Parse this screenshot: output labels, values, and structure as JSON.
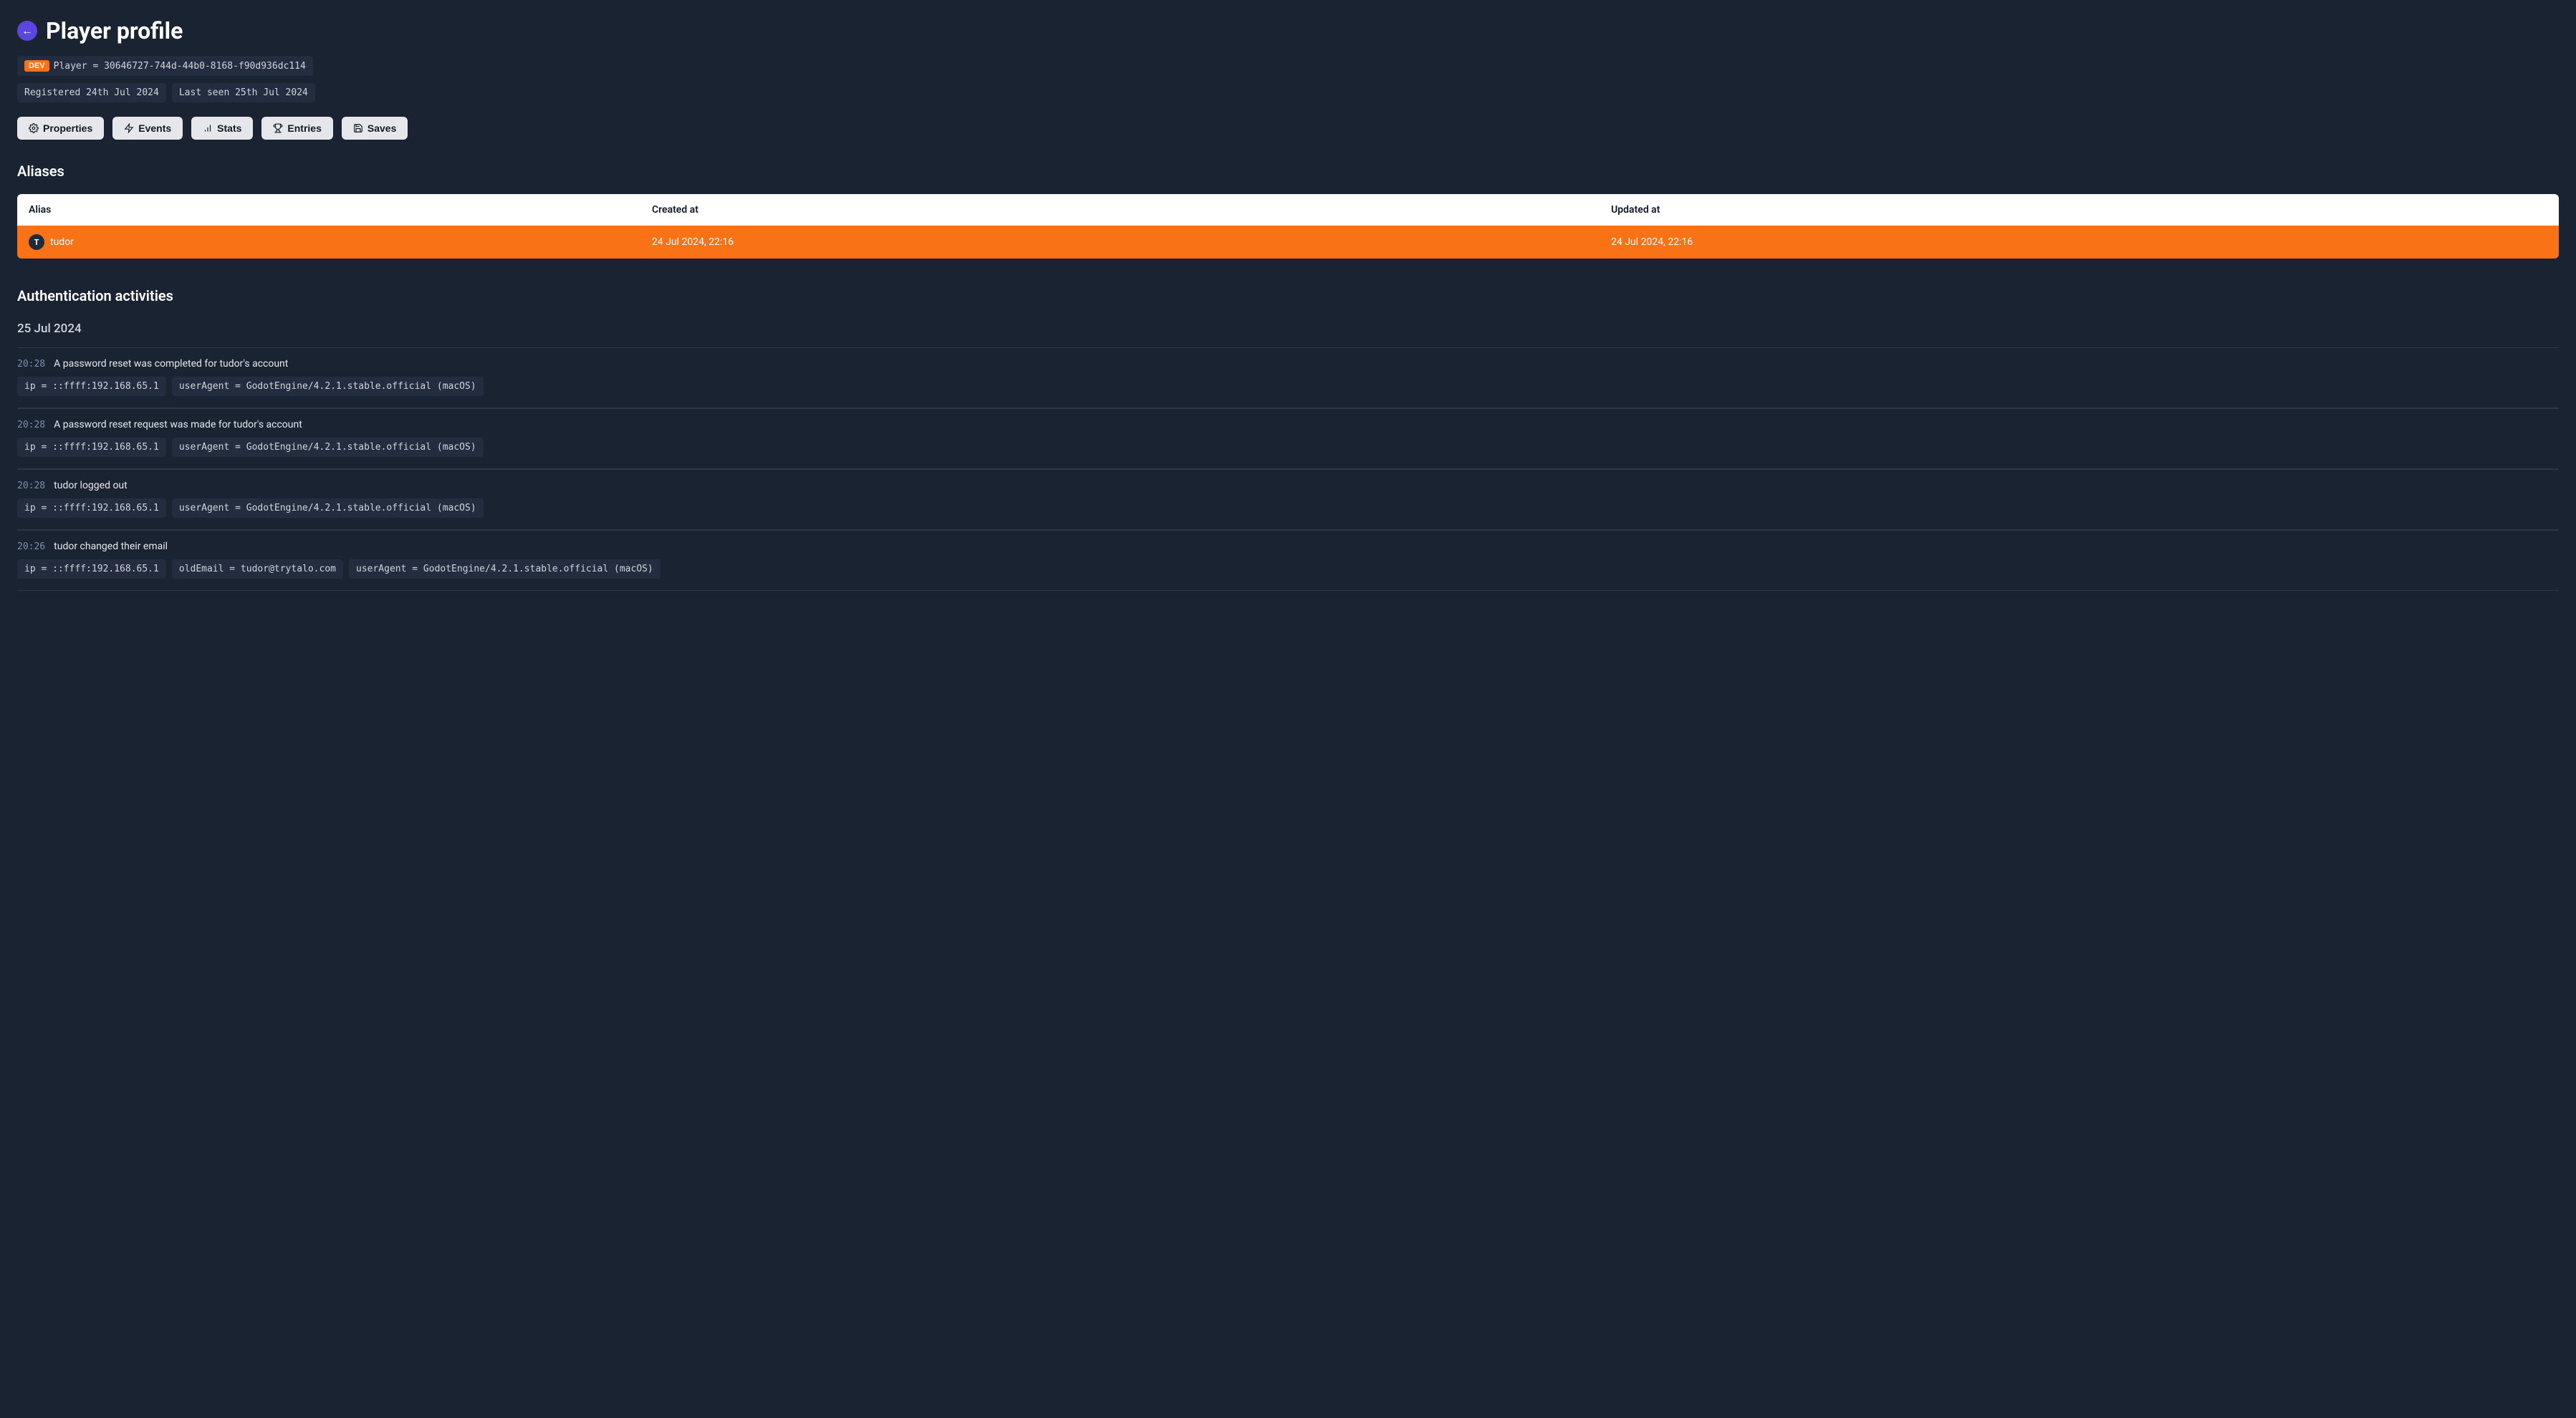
{
  "header": {
    "title": "Player profile",
    "dev_badge": "DEV",
    "player_id": "Player = 30646727-744d-44b0-8168-f90d936dc114",
    "registered": "Registered 24th Jul 2024",
    "last_seen": "Last seen 25th Jul 2024"
  },
  "buttons": {
    "properties": "Properties",
    "events": "Events",
    "stats": "Stats",
    "entries": "Entries",
    "saves": "Saves"
  },
  "aliases": {
    "title": "Aliases",
    "columns": {
      "alias": "Alias",
      "created": "Created at",
      "updated": "Updated at"
    },
    "rows": [
      {
        "alias": "tudor",
        "created": "24 Jul 2024, 22:16",
        "updated": "24 Jul 2024, 22:16"
      }
    ]
  },
  "auth": {
    "title": "Authentication activities",
    "groups": [
      {
        "date": "25 Jul 2024",
        "activities": [
          {
            "time": "20:28",
            "desc": "A password reset was completed for tudor's account",
            "meta": [
              "ip = ::ffff:192.168.65.1",
              "userAgent = GodotEngine/4.2.1.stable.official (macOS)"
            ]
          },
          {
            "time": "20:28",
            "desc": "A password reset request was made for tudor's account",
            "meta": [
              "ip = ::ffff:192.168.65.1",
              "userAgent = GodotEngine/4.2.1.stable.official (macOS)"
            ]
          },
          {
            "time": "20:28",
            "desc": "tudor logged out",
            "meta": [
              "ip = ::ffff:192.168.65.1",
              "userAgent = GodotEngine/4.2.1.stable.official (macOS)"
            ]
          },
          {
            "time": "20:26",
            "desc": "tudor changed their email",
            "meta": [
              "ip = ::ffff:192.168.65.1",
              "oldEmail = tudor@trytalo.com",
              "userAgent = GodotEngine/4.2.1.stable.official (macOS)"
            ]
          }
        ]
      }
    ]
  }
}
